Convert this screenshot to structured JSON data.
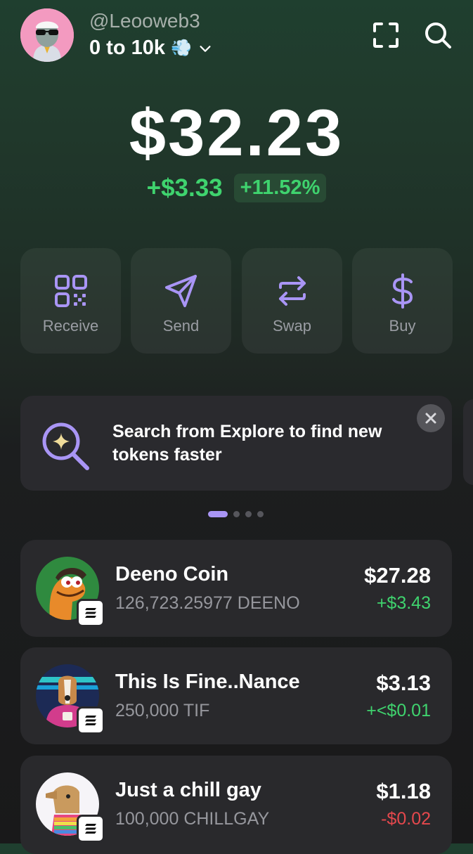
{
  "header": {
    "username": "@Leooweb3",
    "wallet_name": "0 to 10k",
    "wallet_emoji": "💨",
    "icons": [
      "avatar",
      "chevron-down-icon",
      "scan-icon",
      "search-icon"
    ]
  },
  "balance": {
    "total": "$32.23",
    "change_amount": "+$3.33",
    "change_percent": "+11.52%"
  },
  "actions": [
    {
      "label": "Receive",
      "icon": "qr-code-icon"
    },
    {
      "label": "Send",
      "icon": "send-icon"
    },
    {
      "label": "Swap",
      "icon": "swap-icon"
    },
    {
      "label": "Buy",
      "icon": "dollar-icon"
    }
  ],
  "banner": {
    "text": "Search from Explore to find new tokens faster",
    "icon": "search-sparkle-icon",
    "close_icon": "close-icon"
  },
  "carousel": {
    "pages": 4,
    "active": 1
  },
  "tokens": [
    {
      "name": "Deeno Coin",
      "amount": "126,723.25977 DEENO",
      "value": "$27.28",
      "change": "+$3.43",
      "trend": "positive"
    },
    {
      "name": "This Is Fine..Nance",
      "amount": "250,000 TIF",
      "value": "$3.13",
      "change": "+<$0.01",
      "trend": "positive"
    },
    {
      "name": "Just a chill gay",
      "amount": "100,000 CHILLGAY",
      "value": "$1.18",
      "change": "-$0.02",
      "trend": "negative"
    }
  ],
  "colors": {
    "positive": "#3fd36e",
    "negative": "#e5484d",
    "accent": "#a995f5",
    "card": "#29292c"
  }
}
